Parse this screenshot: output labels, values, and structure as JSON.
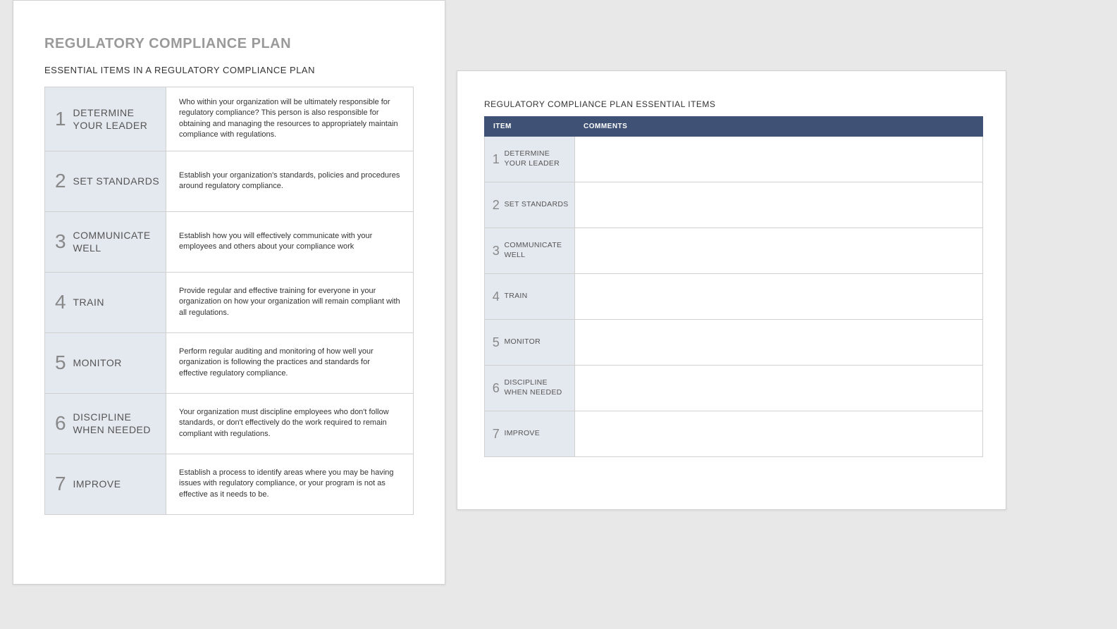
{
  "left": {
    "title": "REGULATORY COMPLIANCE PLAN",
    "subtitle": "ESSENTIAL ITEMS IN A REGULATORY COMPLIANCE PLAN",
    "rows": [
      {
        "num": "1",
        "label": "DETERMINE YOUR LEADER",
        "desc": "Who within your organization will be ultimately responsible for regulatory compliance? This person is also responsible for obtaining and managing the resources to appropriately maintain compliance with regulations."
      },
      {
        "num": "2",
        "label": "SET STANDARDS",
        "desc": "Establish your organization's standards, policies and procedures around regulatory compliance."
      },
      {
        "num": "3",
        "label": "COMMUNICATE WELL",
        "desc": "Establish how you will effectively communicate with your employees and others about your compliance work"
      },
      {
        "num": "4",
        "label": "TRAIN",
        "desc": "Provide regular and effective training for everyone in your organization on how your organization will remain compliant with all regulations."
      },
      {
        "num": "5",
        "label": "MONITOR",
        "desc": "Perform regular auditing and monitoring of how well your organization is following the practices and standards for effective regulatory compliance."
      },
      {
        "num": "6",
        "label": "DISCIPLINE WHEN NEEDED",
        "desc": "Your organization must discipline employees who don't follow standards, or don't effectively do the work required to remain compliant with regulations."
      },
      {
        "num": "7",
        "label": "IMPROVE",
        "desc": "Establish a process to identify areas where you may be having issues with regulatory compliance, or your program is not as effective as it needs to be."
      }
    ]
  },
  "right": {
    "title": "REGULATORY COMPLIANCE PLAN ESSENTIAL ITEMS",
    "headers": {
      "item": "ITEM",
      "comments": "COMMENTS"
    },
    "rows": [
      {
        "num": "1",
        "label": "DETERMINE YOUR LEADER",
        "comment": ""
      },
      {
        "num": "2",
        "label": "SET STANDARDS",
        "comment": ""
      },
      {
        "num": "3",
        "label": "COMMUNICATE WELL",
        "comment": ""
      },
      {
        "num": "4",
        "label": "TRAIN",
        "comment": ""
      },
      {
        "num": "5",
        "label": "MONITOR",
        "comment": ""
      },
      {
        "num": "6",
        "label": "DISCIPLINE WHEN NEEDED",
        "comment": ""
      },
      {
        "num": "7",
        "label": "IMPROVE",
        "comment": ""
      }
    ]
  }
}
